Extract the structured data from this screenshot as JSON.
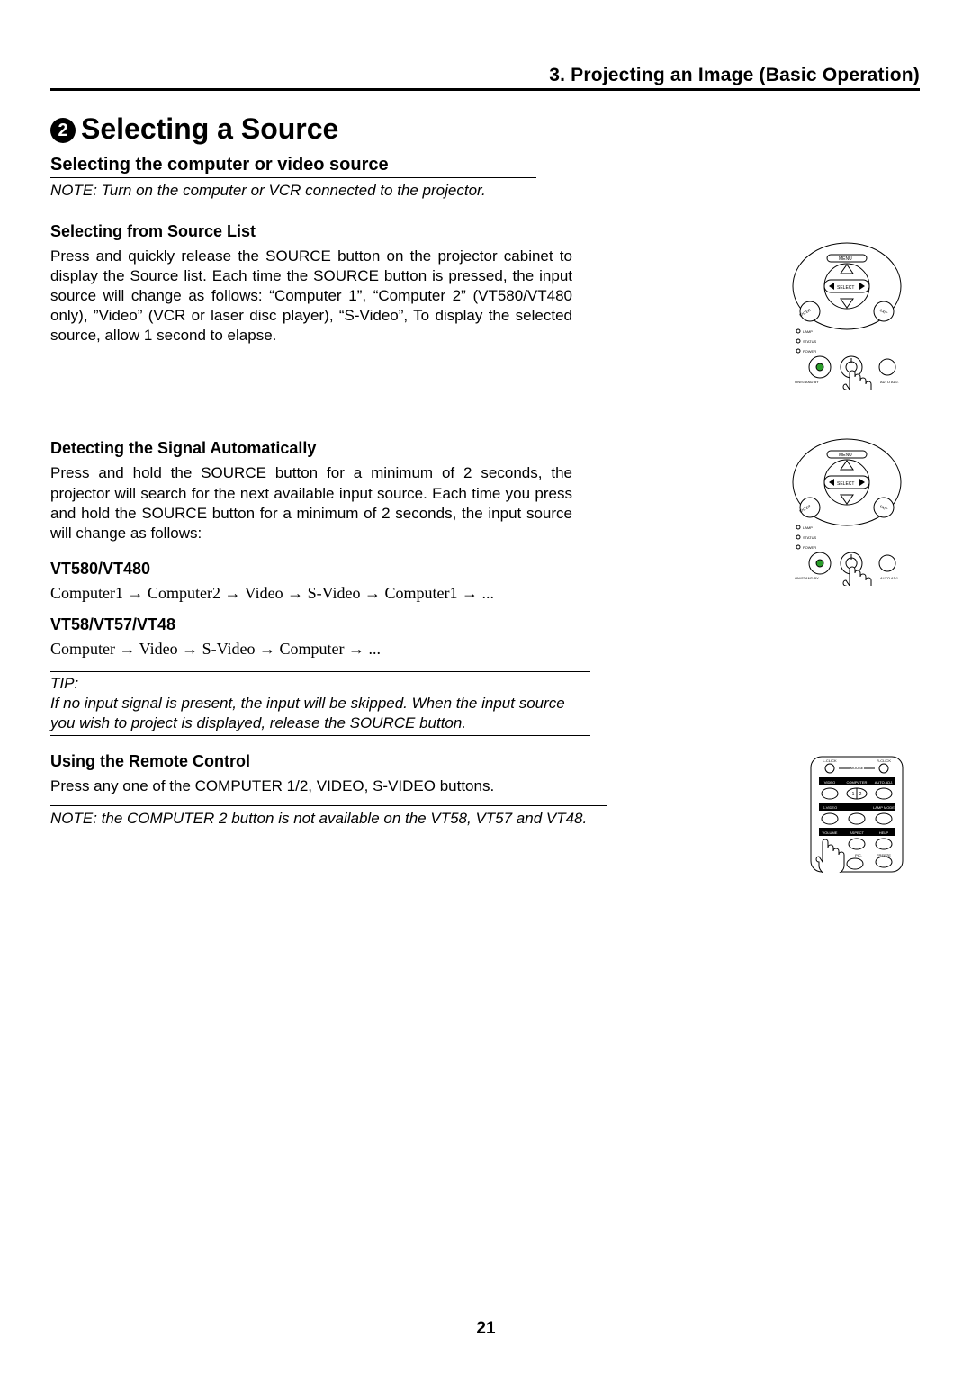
{
  "header": {
    "section": "3. Projecting an Image (Basic Operation)"
  },
  "title": {
    "number": "2",
    "text": "Selecting a Source"
  },
  "subtitle": "Selecting the computer or video source",
  "note1": "NOTE: Turn on the computer or VCR connected to the projector.",
  "sec1": {
    "head": "Selecting from Source List",
    "body": "Press and quickly release the SOURCE button on the projector cabinet to display the Source list. Each time the SOURCE button is pressed, the input source will change as follows: “Computer 1”, “Computer 2” (VT580/VT480 only), ”Video” (VCR or laser disc player), “S-Video”, To display the selected source,  allow 1 second to elapse."
  },
  "sec2": {
    "head": "Detecting the Signal Automatically",
    "body": "Press and hold the SOURCE button for a minimum of 2 seconds, the projector will search for the next available input source. Each time you press and hold the SOURCE button for a minimum of 2 seconds, the input source will change as follows:"
  },
  "sec3": {
    "head": "VT580/VT480",
    "chain": "Computer1 → Computer2 → Video → S-Video →  Computer1 → ..."
  },
  "sec4": {
    "head": "VT58/VT57/VT48",
    "chain": "Computer → Video → S-Video →  Computer → ..."
  },
  "tip": "TIP:\nIf no input signal is present, the input will be skipped. When the input source you wish to project is displayed, release the SOURCE button.",
  "sec5": {
    "head": "Using the Remote Control",
    "body": "Press any one of the COMPUTER 1/2, VIDEO, S-VIDEO buttons."
  },
  "note2": "NOTE: the COMPUTER 2 button is not available on the VT58, VT57 and VT48.",
  "diagrams": {
    "controlpad_labels": {
      "menu": "MENU",
      "select": "SELECT",
      "enter": "ENTER",
      "exit": "EXIT",
      "lamp": "LAMP",
      "status": "STATUS",
      "power": "POWER",
      "onstandby": "ON/STAND BY",
      "autoadj": "AUTO ADJ."
    },
    "remote_labels": {
      "lclick": "L-CLICK",
      "rclick": "R-CLICK",
      "mouse": "MOUSE",
      "video": "VIDEO",
      "computer": "COMPUTER",
      "autoadj": "AUTO ADJ.",
      "svideo": "S-VIDEO",
      "lampmode": "LAMP MODE",
      "volume": "VOLUME",
      "aspect": "ASPECT",
      "help": "HELP",
      "pic": "PIC.",
      "freeze": "FREEZE"
    }
  },
  "page_number": "21"
}
